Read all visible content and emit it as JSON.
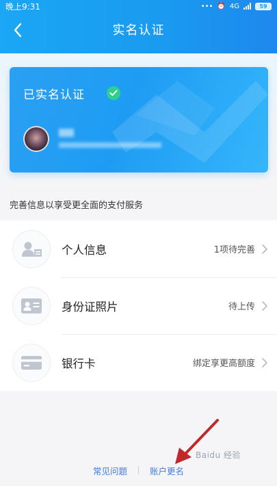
{
  "status_bar": {
    "time": "晚上9:31",
    "network_label": "4G",
    "battery": "59"
  },
  "nav": {
    "title": "实名认证",
    "back_icon": "chevron-left-icon"
  },
  "card": {
    "title": "已实名认证",
    "badge_icon": "check-icon"
  },
  "section_tip": "完善信息以享受更全面的支付服务",
  "items": [
    {
      "label": "个人信息",
      "status": "1项待完善",
      "icon": "person-card-icon"
    },
    {
      "label": "身份证照片",
      "status": "待上传",
      "icon": "id-card-icon"
    },
    {
      "label": "银行卡",
      "status": "绑定享更高额度",
      "icon": "bank-card-icon"
    }
  ],
  "footer": {
    "faq": "常见问题",
    "rename": "账户更名"
  },
  "watermark": "Baidu 经验",
  "colors": {
    "header": "#1a9af0",
    "badge": "#2fd08d",
    "link": "#3f7fdb",
    "arrow": "#c0282a"
  }
}
